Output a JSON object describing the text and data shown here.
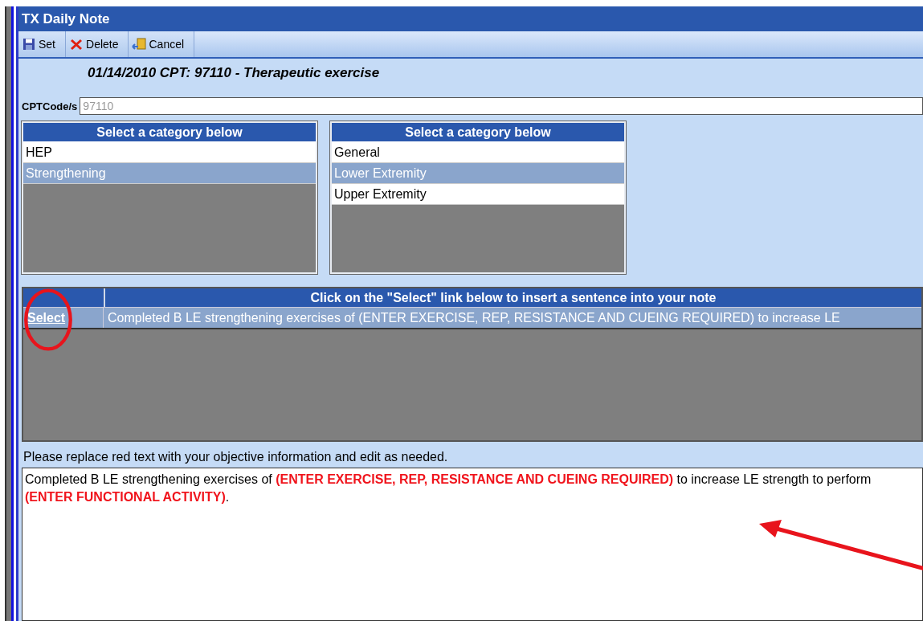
{
  "window": {
    "title": "TX Daily Note"
  },
  "toolbar": [
    {
      "label": "Set",
      "kind": "save"
    },
    {
      "label": "Delete",
      "kind": "delete"
    },
    {
      "label": "Cancel",
      "kind": "cancel"
    }
  ],
  "heading": "01/14/2010  CPT: 97110 -  Therapeutic exercise",
  "cpt_field": {
    "label": "CPTCode/s",
    "value": "97110"
  },
  "category_lists": [
    {
      "title": "Select a category below",
      "items": [
        {
          "label": "HEP",
          "selected": false
        },
        {
          "label": "Strengthening",
          "selected": true
        }
      ]
    },
    {
      "title": "Select a category below",
      "items": [
        {
          "label": "General",
          "selected": false
        },
        {
          "label": "Lower Extremity",
          "selected": true
        },
        {
          "label": "Upper Extremity",
          "selected": false
        }
      ]
    }
  ],
  "sentence_table": {
    "columns": [
      "Click on the \"Select\" link below to insert a sentence into your note"
    ],
    "rows": [
      {
        "link": "Select",
        "text": "Completed B LE strengthening exercises of (ENTER EXERCISE, REP, RESISTANCE AND CUEING REQUIRED) to increase LE",
        "selected": true
      }
    ]
  },
  "instruction": "Please replace red text with your objective information and edit as needed.",
  "note_text": "Completed B LE strengthening exercises of **(ENTER EXERCISE, REP, RESISTANCE AND CUEING REQUIRED)** to increase LE strength to perform **(ENTER FUNCTIONAL ACTIVITY)**."
}
